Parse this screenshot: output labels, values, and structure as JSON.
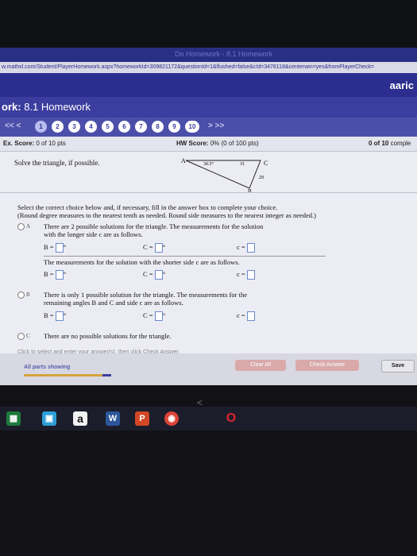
{
  "browser": {
    "tab_ghost": "Do Homework - 8.1 Homework",
    "url": "w.mathxl.com/Student/PlayerHomework.aspx?homeworkId=309821172&questionId=1&flushed=false&cId=3476118&centerwin=yes&fromPlayerCheck="
  },
  "site": {
    "user": "aaric"
  },
  "homework": {
    "title_prefix": "ork:",
    "title": "8.1 Homework"
  },
  "nav": {
    "prev_label": "<<  <",
    "next_label": ">  >>",
    "questions": [
      "1",
      "2",
      "3",
      "4",
      "5",
      "6",
      "7",
      "8",
      "9",
      "10"
    ],
    "current": "1"
  },
  "score": {
    "ex_label": "Ex. Score:",
    "ex_value": "0 of 10 pts",
    "hw_label": "HW Score:",
    "hw_value": "0% (0 of 100 pts)",
    "right_value": "0 of 10",
    "right_suffix": "comple"
  },
  "problem": {
    "prompt": "Solve the triangle, if possible.",
    "triangle": {
      "A": "A",
      "B": "B",
      "C": "C",
      "angle_A": "30.5°",
      "side_b": "31",
      "side_a": "29"
    }
  },
  "instructions": {
    "line1": "Select the correct choice below and, if necessary, fill in the answer box to complete your choice.",
    "line2": "(Round degree measures to the nearest tenth as needed. Round side measures to the nearest integer as needed.)"
  },
  "choices": {
    "A": {
      "letter": "A",
      "line1": "There are 2 possible solutions for the triangle. The measurements for the solution",
      "line2": "with the longer side c are as follows.",
      "line3": "The measurements for the solution with the shorter side c are as follows."
    },
    "B": {
      "letter": "B",
      "line1": "There is only 1 possible solution for the triangle. The measurements for the",
      "line2": "remaining angles B and C and side c are as follows."
    },
    "C": {
      "letter": "C",
      "line1": "There are no possible solutions for the triangle."
    }
  },
  "vars": {
    "B": "B =",
    "Cang": "C =",
    "c": "c =",
    "deg": "°"
  },
  "hint": "Click to select and enter your answer(s), then click Check Answer.",
  "footer": {
    "all_parts": "All parts showing",
    "progress_fraction": 0.9,
    "clear_all": "Clear All",
    "check_answer": "Check Answer",
    "save": "Save"
  },
  "taskbar": {
    "back": "<",
    "icons": [
      "excel-icon",
      "store-icon",
      "amazon-icon",
      "word-icon",
      "powerpoint-icon",
      "chrome-icon",
      "opera-icon"
    ],
    "amazon_glyph": "a",
    "word_glyph": "W",
    "ppt_glyph": "P"
  }
}
